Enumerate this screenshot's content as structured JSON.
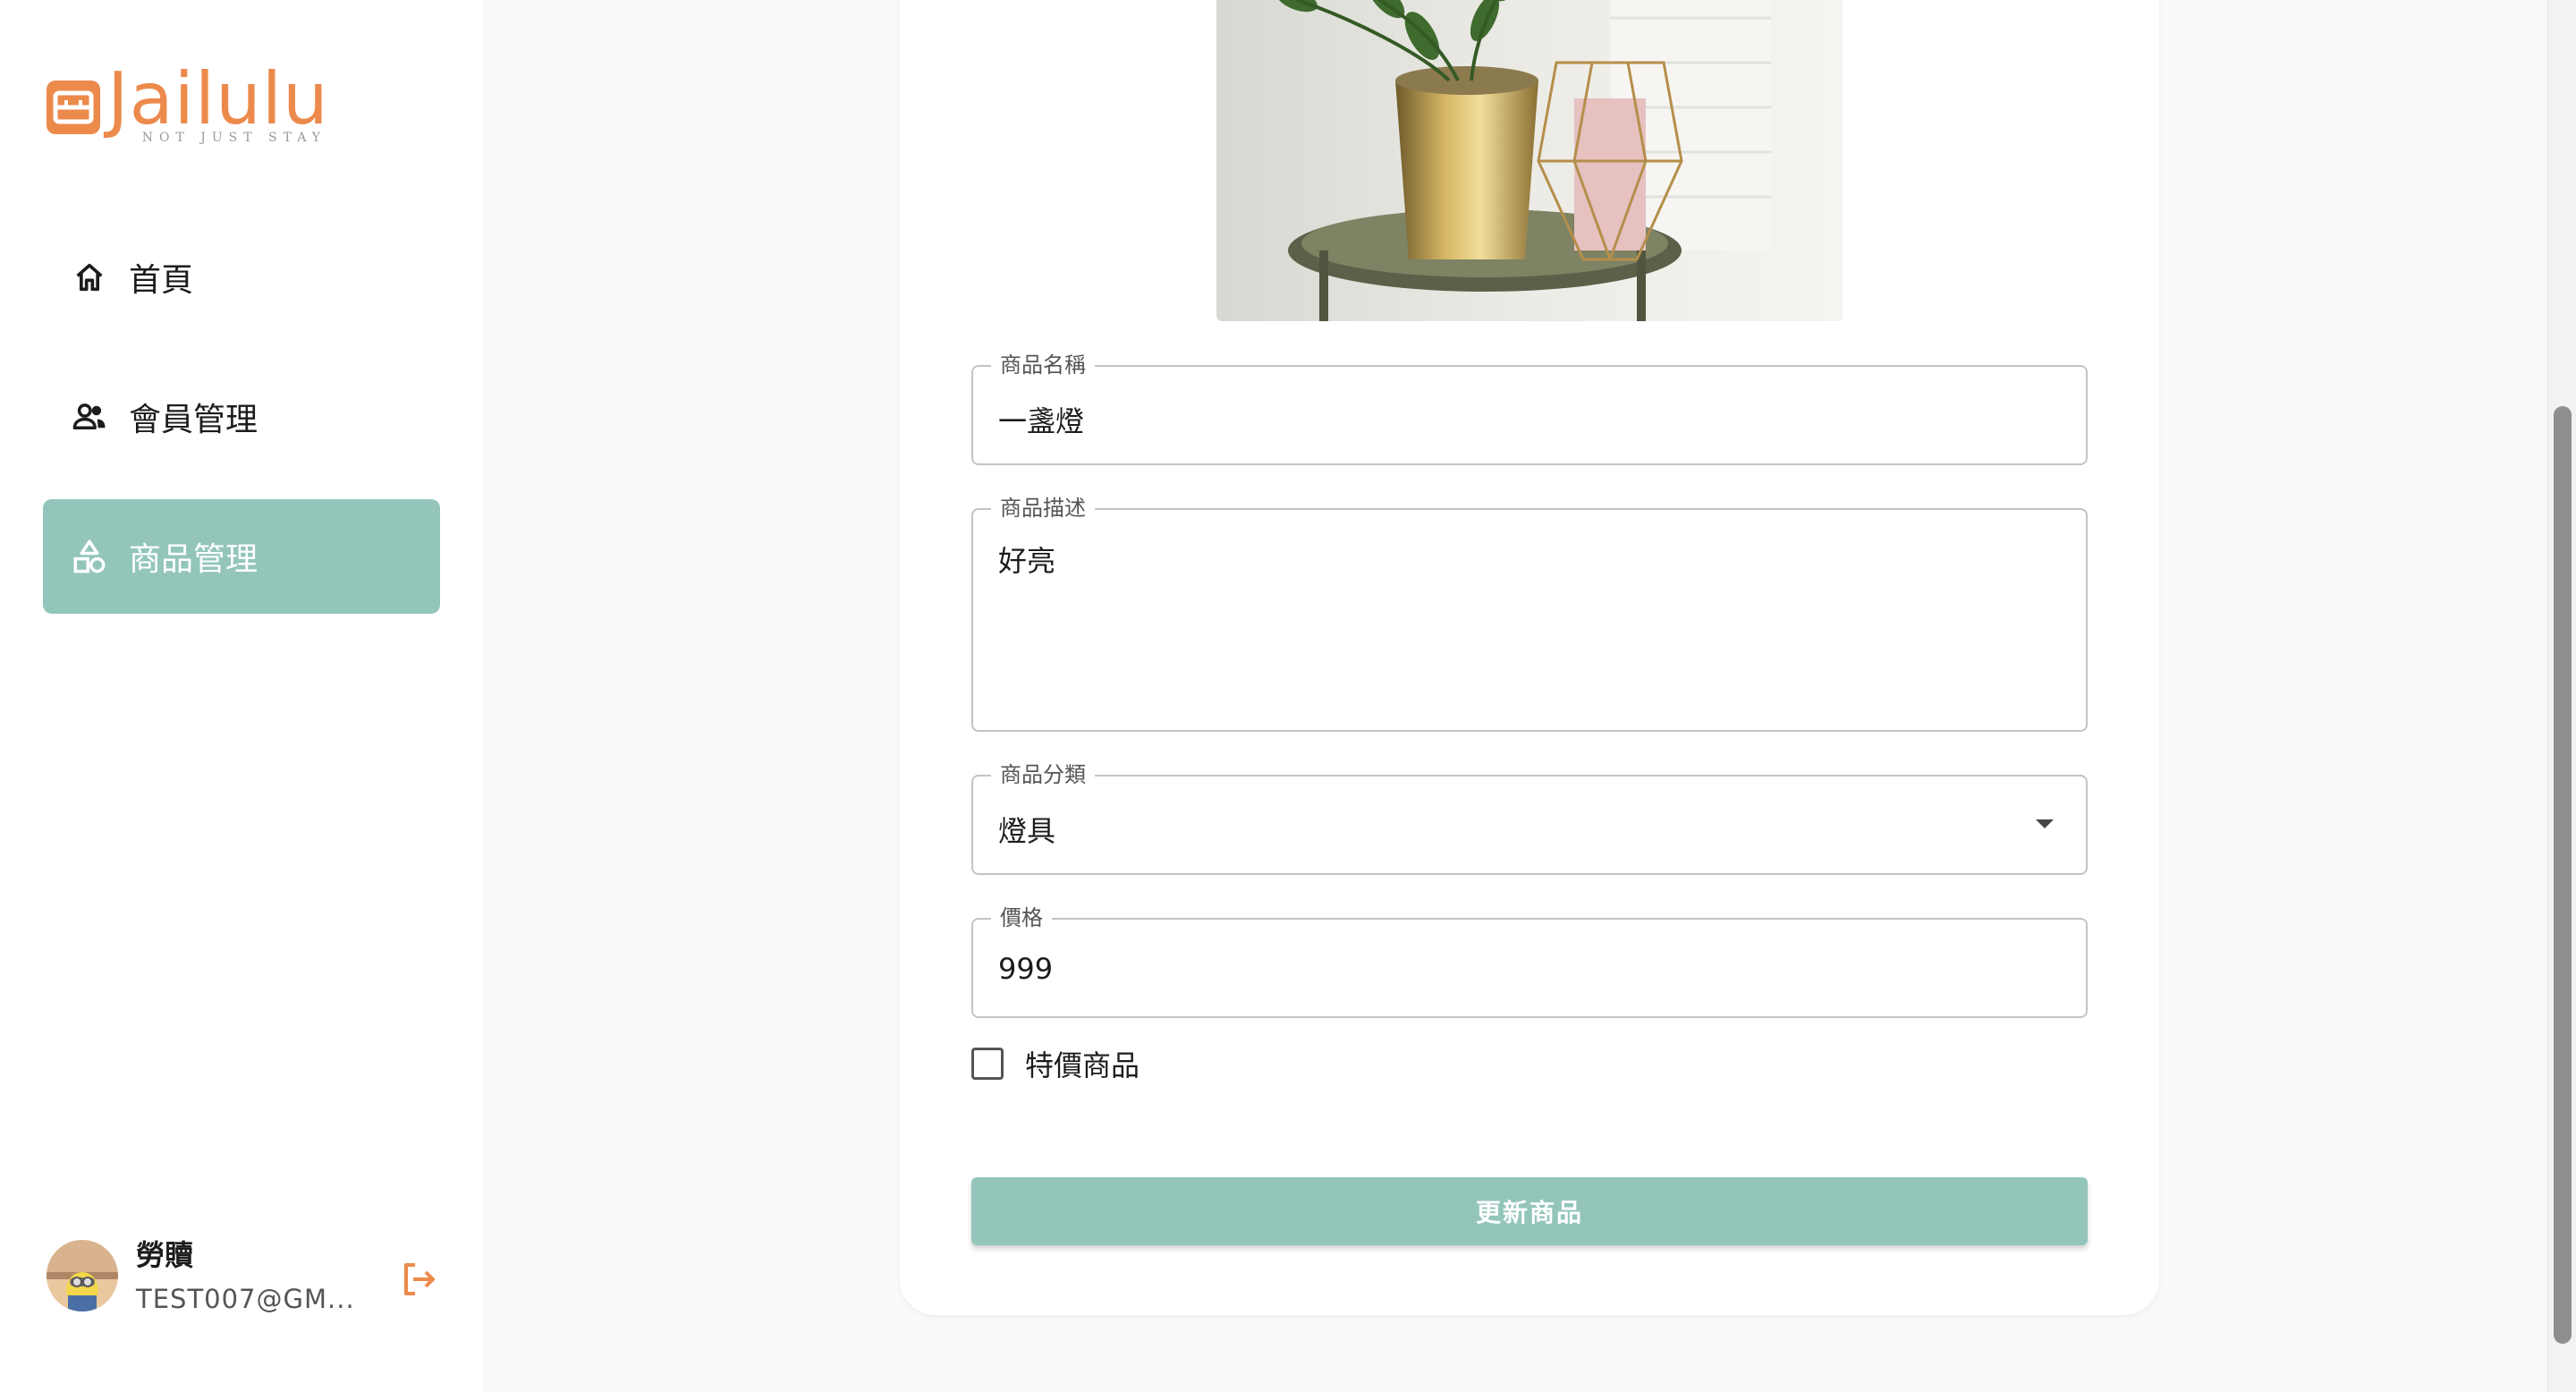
{
  "brand": {
    "name": "Jailulu",
    "tagline": "NOT JUST STAY",
    "accent_color": "#ec8a4c"
  },
  "sidebar": {
    "items": [
      {
        "label": "首頁",
        "icon": "home-icon",
        "active": false
      },
      {
        "label": "會員管理",
        "icon": "people-icon",
        "active": false
      },
      {
        "label": "商品管理",
        "icon": "category-icon",
        "active": true
      }
    ],
    "active_color": "#93c5bb"
  },
  "user": {
    "name": "勞贖",
    "email": "TEST007@GM...",
    "logout_icon": "logout-icon"
  },
  "form": {
    "name": {
      "label": "商品名稱",
      "value": "一盞燈"
    },
    "description": {
      "label": "商品描述",
      "value": "好亮"
    },
    "category": {
      "label": "商品分類",
      "value": "燈具"
    },
    "price": {
      "label": "價格",
      "value": "999"
    },
    "special_checkbox": {
      "label": "特價商品",
      "checked": false
    },
    "submit_label": "更新商品"
  }
}
